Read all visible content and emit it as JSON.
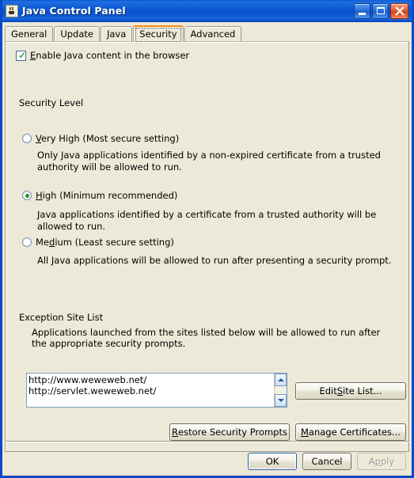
{
  "window": {
    "title": "Java Control Panel",
    "icon": "java-coffee-cup-icon",
    "minimize_label": "Minimize",
    "maximize_label": "Maximize",
    "close_label": "Close"
  },
  "tabs": [
    {
      "label": "General",
      "selected": false
    },
    {
      "label": "Update",
      "selected": false
    },
    {
      "label": "Java",
      "selected": false
    },
    {
      "label": "Security",
      "selected": true
    },
    {
      "label": "Advanced",
      "selected": false
    }
  ],
  "enable_java": {
    "label_before": "E",
    "label_after": "nable Java content in the browser",
    "checked": true
  },
  "security_level": {
    "label": "Security Level",
    "options": [
      {
        "mnemonic_before": "V",
        "mnemonic_after": "ery High (Most secure setting)",
        "selected": false,
        "description": "Only Java applications identified by a non-expired certificate from a trusted authority will be allowed to run."
      },
      {
        "mnemonic_before": "H",
        "mnemonic_after": "igh (Minimum recommended)",
        "selected": true,
        "description": "Java applications identified by a certificate from a trusted authority will be allowed to run."
      },
      {
        "mnemonic_pre": "Me",
        "mnemonic_before": "d",
        "mnemonic_after": "ium (Least secure setting)",
        "selected": false,
        "description": "All Java applications will be allowed to run after presenting a security prompt."
      }
    ]
  },
  "exception_site_list": {
    "label": "Exception Site List",
    "description": "Applications launched from the sites listed below will be allowed to run after the appropriate security prompts.",
    "sites": [
      "http://www.weweweb.net/",
      "http://servlet.weweweb.net/"
    ],
    "edit_button": {
      "pre": "Edit ",
      "mnemonic": "S",
      "post": "ite List..."
    },
    "scroll_up": "scroll-up-arrow-icon",
    "scroll_down": "scroll-down-arrow-icon"
  },
  "actions": {
    "restore": {
      "mnemonic": "R",
      "post": "estore Security Prompts"
    },
    "manage": {
      "mnemonic": "M",
      "post": "anage Certificates..."
    }
  },
  "footer": {
    "ok": "OK",
    "cancel": "Cancel",
    "apply_pre": "A",
    "apply_mnemonic": "p",
    "apply_post": "ply",
    "apply_disabled": true
  },
  "colors": {
    "panel_bg": "#ECE9D8",
    "title_blue": "#0A49C8",
    "accent_orange": "#F08A12",
    "check_green": "#1F9D20",
    "close_red": "#D2401F"
  }
}
